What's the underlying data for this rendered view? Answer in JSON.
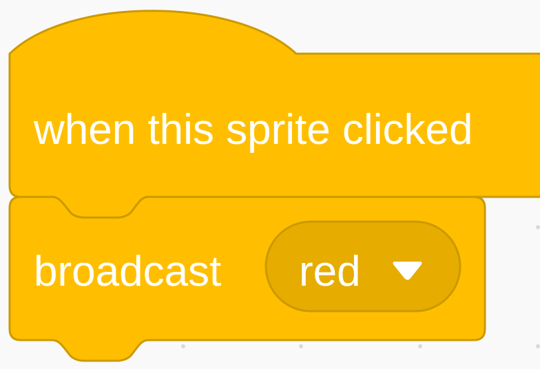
{
  "workspace": {
    "background": "#f9f9f9",
    "grid_dot_color": "#d9d9d9"
  },
  "blocks": {
    "category": "events",
    "fill": "#ffbf00",
    "stroke": "#cc9900",
    "hat": {
      "label": "when this sprite clicked"
    },
    "broadcast": {
      "label": "broadcast",
      "dropdown": {
        "value": "red",
        "fill": "#e6ac00",
        "arrow_icon": "triangle-down-icon"
      }
    }
  }
}
